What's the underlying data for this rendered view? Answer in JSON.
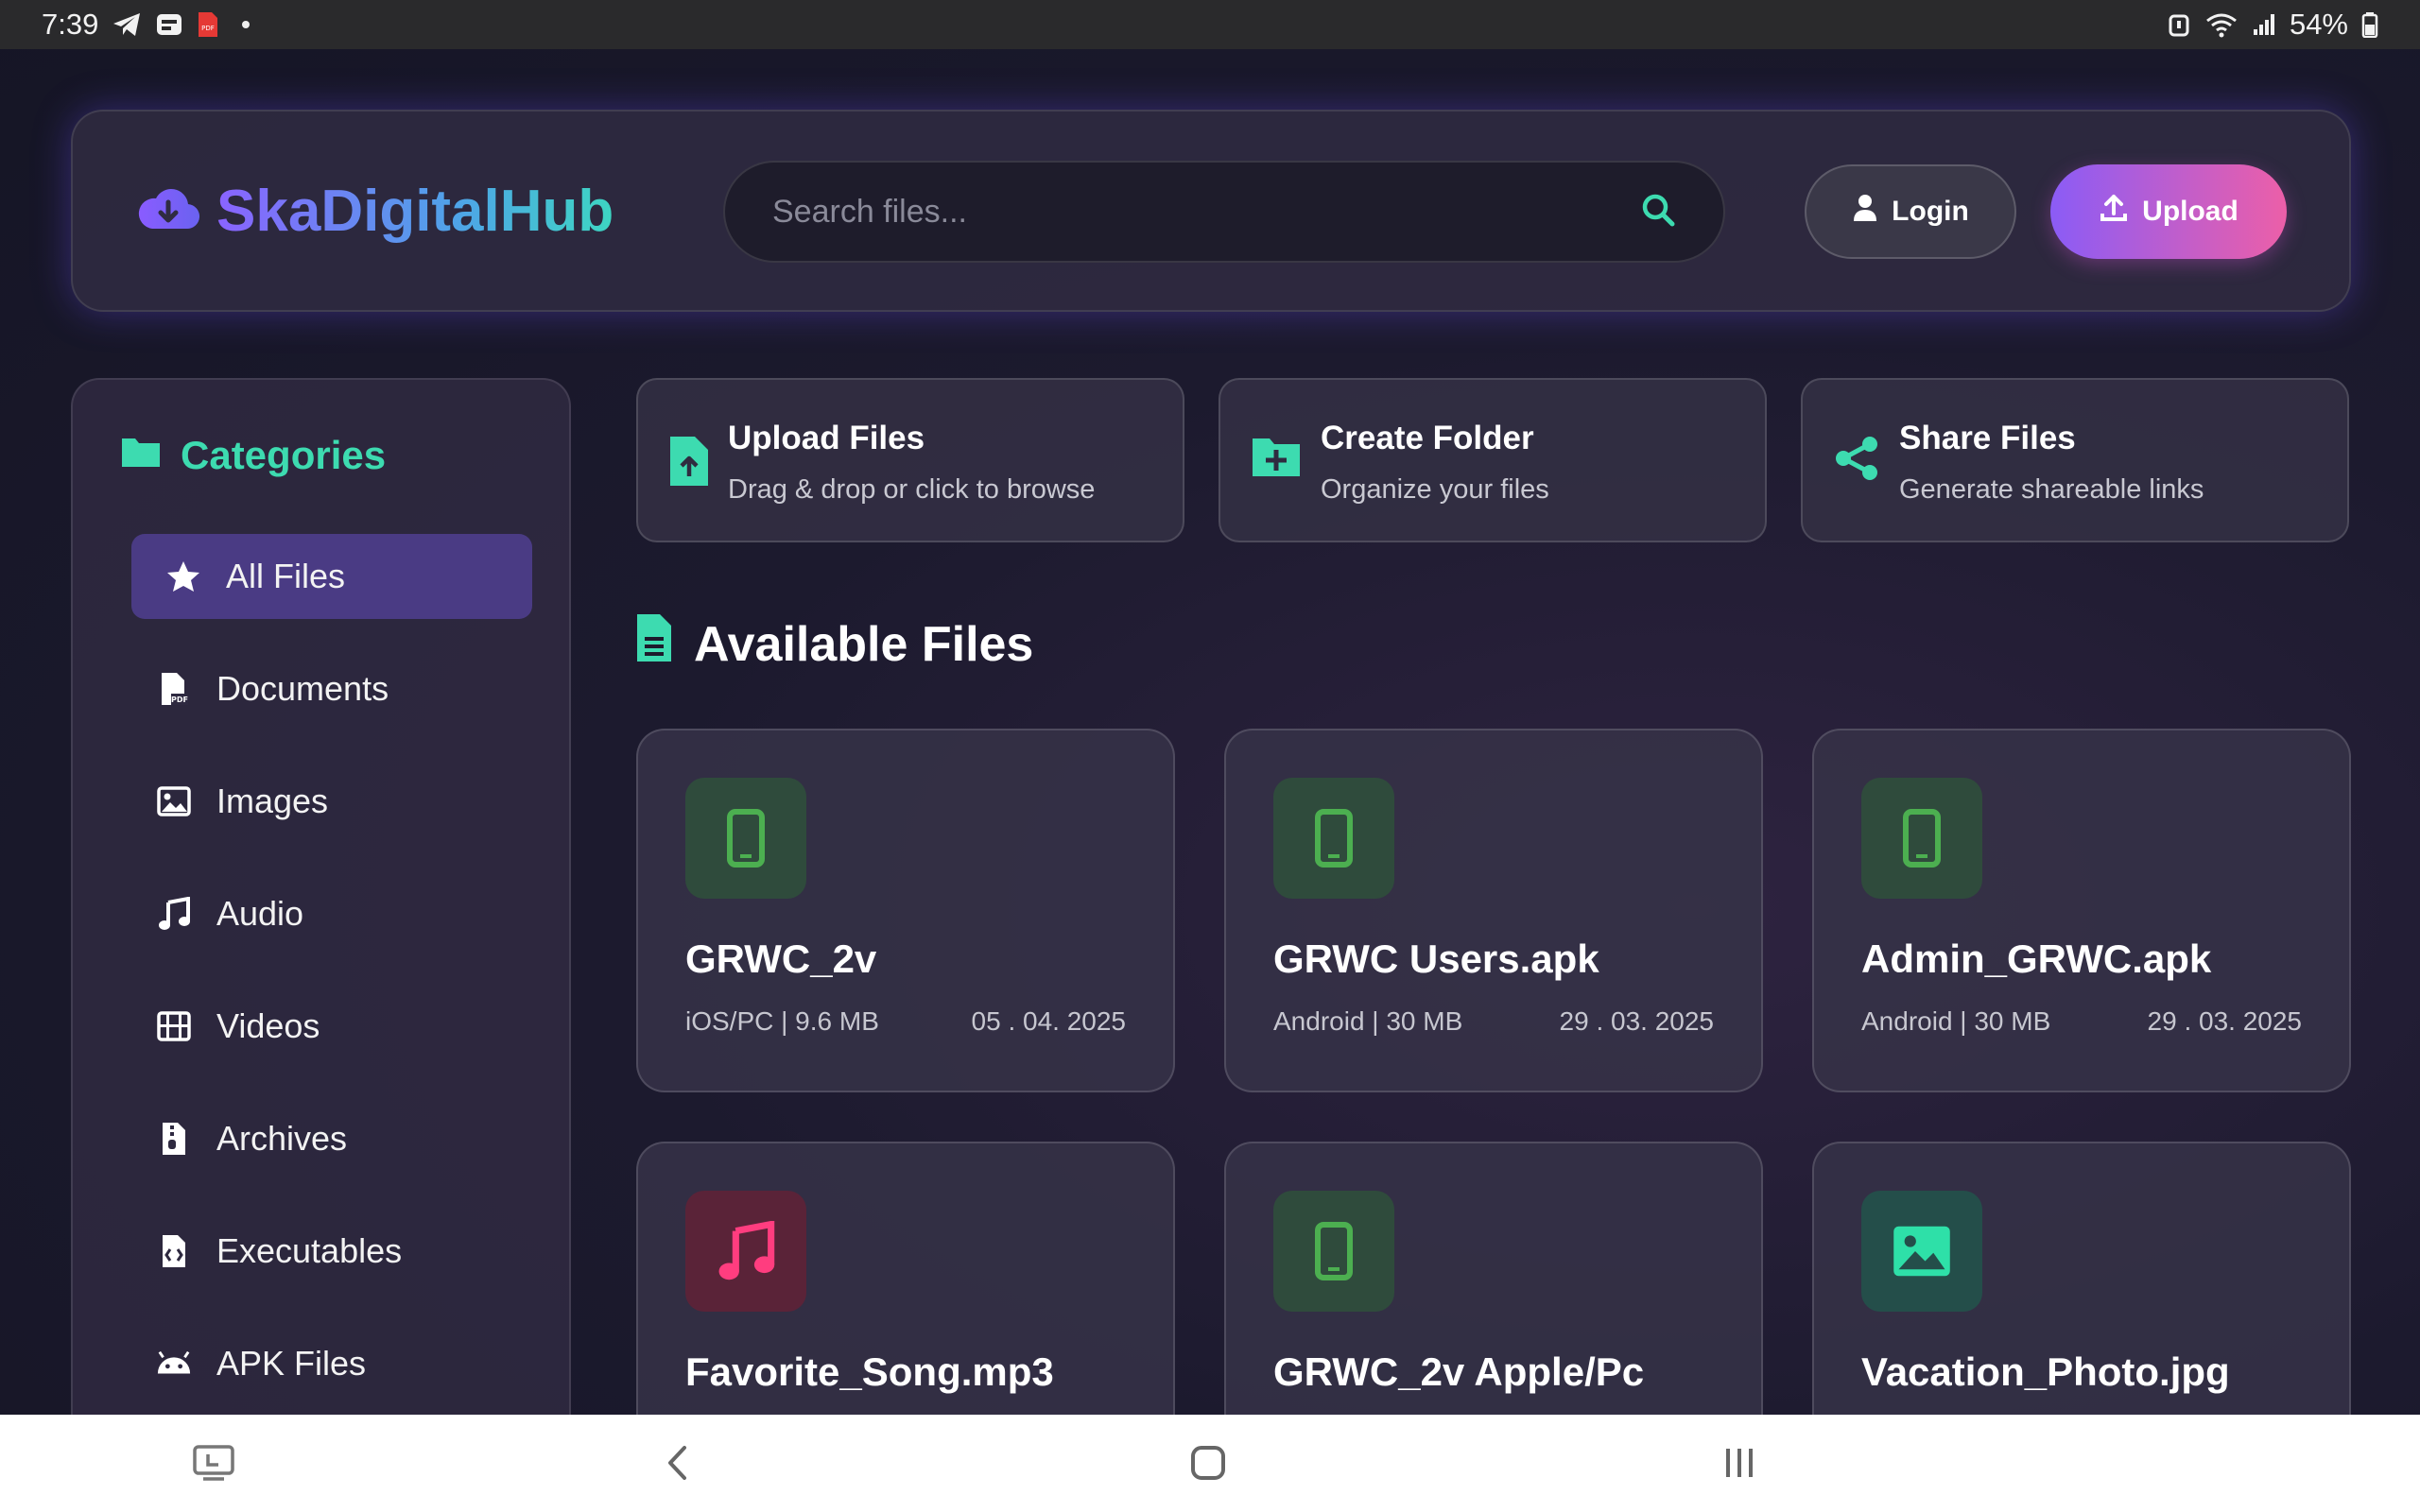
{
  "status_bar": {
    "time": "7:39",
    "battery": "54%",
    "icons": [
      "telegram-icon",
      "chat-icon",
      "pdf-icon",
      "notification-dot",
      "alarm-icon",
      "wifi-icon",
      "signal-icon",
      "battery-icon"
    ]
  },
  "header": {
    "brand": "SkaDigitalHub",
    "brand_icon": "cloud-download-icon",
    "search_placeholder": "Search files...",
    "login_label": "Login",
    "upload_label": "Upload"
  },
  "sidebar": {
    "title": "Categories",
    "items": [
      {
        "label": "All Files",
        "icon": "star-icon",
        "active": true
      },
      {
        "label": "Documents",
        "icon": "pdf-file-icon"
      },
      {
        "label": "Images",
        "icon": "image-icon"
      },
      {
        "label": "Audio",
        "icon": "music-icon"
      },
      {
        "label": "Videos",
        "icon": "film-icon"
      },
      {
        "label": "Archives",
        "icon": "archive-file-icon"
      },
      {
        "label": "Executables",
        "icon": "code-file-icon"
      },
      {
        "label": "APK Files",
        "icon": "android-icon"
      }
    ]
  },
  "quick_actions": [
    {
      "title": "Upload Files",
      "subtitle": "Drag & drop or click to browse",
      "icon": "file-upload-icon"
    },
    {
      "title": "Create Folder",
      "subtitle": "Organize your files",
      "icon": "folder-plus-icon"
    },
    {
      "title": "Share Files",
      "subtitle": "Generate shareable links",
      "icon": "share-icon"
    }
  ],
  "files_section": {
    "title": "Available Files",
    "files": [
      {
        "name": "GRWC_2v",
        "meta": "iOS/PC | 9.6 MB",
        "date": "05 . 04. 2025",
        "icon": "mobile-icon"
      },
      {
        "name": "GRWC Users.apk",
        "meta": "Android | 30 MB",
        "date": "29 . 03. 2025",
        "icon": "mobile-icon"
      },
      {
        "name": "Admin_GRWC.apk",
        "meta": "Android | 30 MB",
        "date": "29 . 03. 2025",
        "icon": "mobile-icon"
      },
      {
        "name": "Favorite_Song.mp3",
        "icon": "music-icon"
      },
      {
        "name": "GRWC_2v Apple/Pc",
        "icon": "mobile-icon"
      },
      {
        "name": "Vacation_Photo.jpg",
        "icon": "image-icon"
      }
    ]
  },
  "colors": {
    "accent_green": "#3ddbb0",
    "phone_green": "#4caf50",
    "music_pink": "#ff3d7f",
    "image_teal": "#2ee0a8",
    "upload_gradient": [
      "#8b5cf6",
      "#ec5fa8"
    ]
  }
}
